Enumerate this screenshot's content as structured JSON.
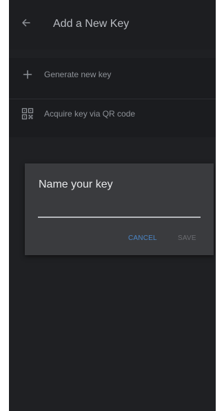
{
  "appbar": {
    "back_icon": "arrow-left-icon",
    "title": "Add a New Key"
  },
  "menu": {
    "items": [
      {
        "icon": "plus-icon",
        "label": "Generate new key"
      },
      {
        "icon": "qr-code-icon",
        "label": "Acquire key via QR code"
      }
    ]
  },
  "dialog": {
    "title": "Name your key",
    "input_value": "",
    "cancel_label": "CANCEL",
    "save_label": "SAVE"
  },
  "colors": {
    "background": "#1f2023",
    "dialog_background": "#3a3b3e",
    "accent": "#4b86c7",
    "disabled": "#6b6c70"
  }
}
